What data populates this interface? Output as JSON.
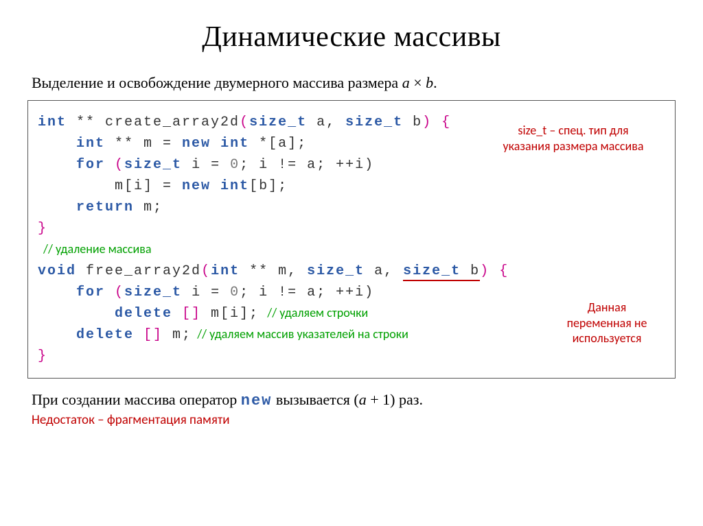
{
  "title": "Динамические массивы",
  "subtitle_prefix": "Выделение и освобождение двумерного массива размера ",
  "subtitle_a": "a",
  "subtitle_times": " × ",
  "subtitle_b": "b",
  "subtitle_suffix": ".",
  "code": {
    "l1_int": "int",
    "l1_rest1": " ** ",
    "l1_fn": "create_array2d",
    "l1_paren_open": "(",
    "l1_szt1": "size_t",
    "l1_a": " a",
    "l1_comma": ", ",
    "l1_szt2": "size_t",
    "l1_b": " b",
    "l1_paren_close": ")",
    "l1_brace": " {",
    "l2_indent": "    ",
    "l2_int": "int",
    "l2_stars": " ** m = ",
    "l2_new": "new",
    "l2_int2": " int",
    "l2_suffix": " *[a];",
    "l3_indent": "    ",
    "l3_for": "for",
    "l3_p1": " (",
    "l3_szt": "size_t",
    "l3_ivar": " i = ",
    "l3_zero": "0",
    "l3_semi": "; i != a; ++i)",
    "l4_indent": "        m[i] = ",
    "l4_new": "new",
    "l4_intb": " int",
    "l4_brk": "[b];",
    "l5_indent": "    ",
    "l5_return": "return",
    "l5_m": " m;",
    "l6_brace": "}",
    "cmt_green1": "// удаление массива",
    "l7_void": "void",
    "l7_sp": " ",
    "l7_fn": "free_array2d",
    "l7_po": "(",
    "l7_int": "int",
    "l7_stars": " ** m, ",
    "l7_szt1": "size_t",
    "l7_a": " a, ",
    "l7_szt2": "size_t",
    "l7_b": " b",
    "l7_pc": ")",
    "l7_brace": " {",
    "l8_indent": "    ",
    "l8_for": "for",
    "l8_p1": " (",
    "l8_szt": "size_t",
    "l8_ivar": " i = ",
    "l8_zero": "0",
    "l8_rest": "; i != a; ++i)",
    "l9_indent": "        ",
    "l9_del": "delete",
    "l9_brk": " []",
    "l9_mi": " m[i];",
    "cmt_green2": "   // удаляем строчки",
    "l10_indent": "    ",
    "l10_del": "delete",
    "l10_brk": " []",
    "l10_m": " m;",
    "cmt_green3": "  // удаляем массив указателей на строки",
    "l11_brace": "}"
  },
  "anno": {
    "sizet_1": "size_t – спец. тип для",
    "sizet_2": "указания размера массива",
    "var_unused_1": "Данная",
    "var_unused_2": "переменная не",
    "var_unused_3": "используется"
  },
  "footer": {
    "prefix": "При создании массива оператор ",
    "new": "new",
    "mid": " вызывается ",
    "expr_open": "(",
    "expr_a": "a",
    "expr_plus": " + 1",
    "expr_close": ")",
    "suffix": " раз."
  },
  "footer_red": "Недостаток – фрагментация памяти"
}
